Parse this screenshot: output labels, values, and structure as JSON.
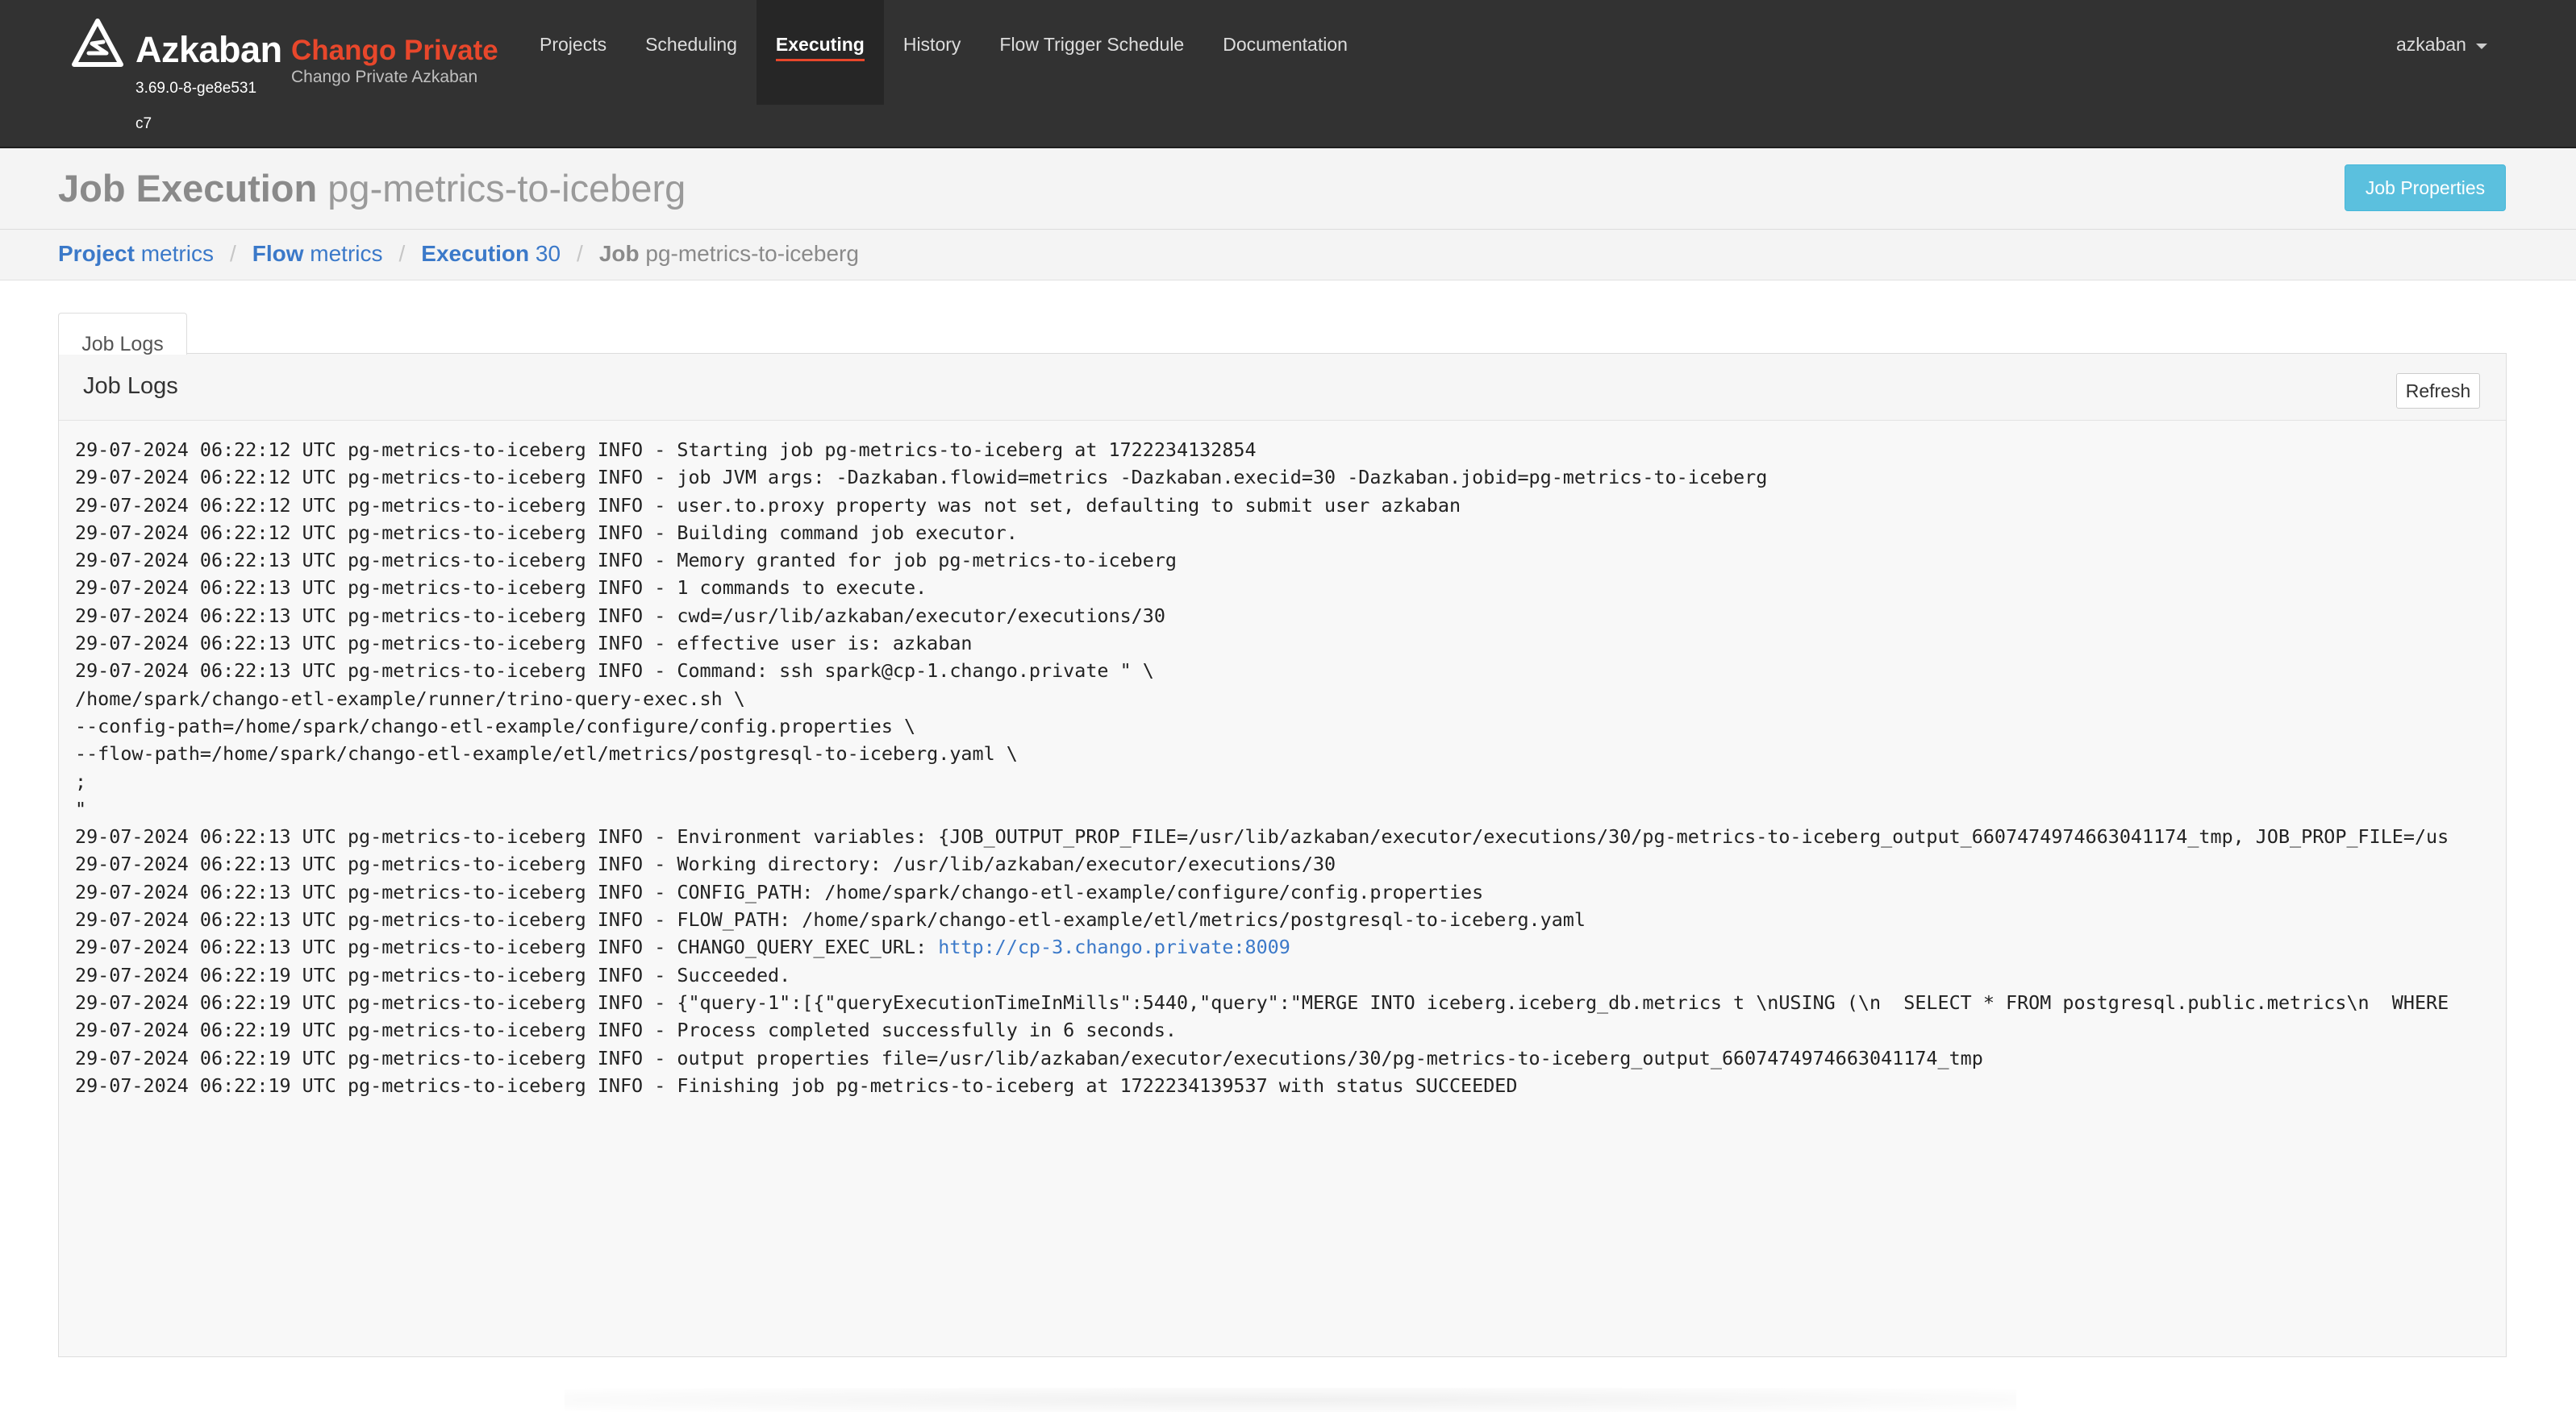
{
  "navbar": {
    "brand": "Azkaban",
    "brand_sub": "Chango Private",
    "brand_sub2": "Chango Private Azkaban",
    "version": "3.69.0-8-ge8e531c7",
    "items": [
      "Projects",
      "Scheduling",
      "Executing",
      "History",
      "Flow Trigger Schedule",
      "Documentation"
    ],
    "active_index": 2,
    "user": "azkaban"
  },
  "header": {
    "title_label": "Job Execution",
    "title_value": "pg-metrics-to-iceberg",
    "job_properties_button": "Job Properties"
  },
  "breadcrumb": {
    "project_label": "Project",
    "project_value": "metrics",
    "flow_label": "Flow",
    "flow_value": "metrics",
    "execution_label": "Execution",
    "execution_value": "30",
    "job_label": "Job",
    "job_value": "pg-metrics-to-iceberg"
  },
  "tab": {
    "label": "Job Logs"
  },
  "panel": {
    "title": "Job Logs",
    "refresh_button": "Refresh",
    "log_lines": [
      "29-07-2024 06:22:12 UTC pg-metrics-to-iceberg INFO - Starting job pg-metrics-to-iceberg at 1722234132854",
      "29-07-2024 06:22:12 UTC pg-metrics-to-iceberg INFO - job JVM args: -Dazkaban.flowid=metrics -Dazkaban.execid=30 -Dazkaban.jobid=pg-metrics-to-iceberg",
      "29-07-2024 06:22:12 UTC pg-metrics-to-iceberg INFO - user.to.proxy property was not set, defaulting to submit user azkaban",
      "29-07-2024 06:22:12 UTC pg-metrics-to-iceberg INFO - Building command job executor.",
      "29-07-2024 06:22:13 UTC pg-metrics-to-iceberg INFO - Memory granted for job pg-metrics-to-iceberg",
      "29-07-2024 06:22:13 UTC pg-metrics-to-iceberg INFO - 1 commands to execute.",
      "29-07-2024 06:22:13 UTC pg-metrics-to-iceberg INFO - cwd=/usr/lib/azkaban/executor/executions/30",
      "29-07-2024 06:22:13 UTC pg-metrics-to-iceberg INFO - effective user is: azkaban",
      "29-07-2024 06:22:13 UTC pg-metrics-to-iceberg INFO - Command: ssh spark@cp-1.chango.private \" \\",
      "/home/spark/chango-etl-example/runner/trino-query-exec.sh \\",
      "--config-path=/home/spark/chango-etl-example/configure/config.properties \\",
      "--flow-path=/home/spark/chango-etl-example/etl/metrics/postgresql-to-iceberg.yaml \\",
      ";",
      "\"",
      "29-07-2024 06:22:13 UTC pg-metrics-to-iceberg INFO - Environment variables: {JOB_OUTPUT_PROP_FILE=/usr/lib/azkaban/executor/executions/30/pg-metrics-to-iceberg_output_6607474974663041174_tmp, JOB_PROP_FILE=/us",
      "29-07-2024 06:22:13 UTC pg-metrics-to-iceberg INFO - Working directory: /usr/lib/azkaban/executor/executions/30",
      "29-07-2024 06:22:13 UTC pg-metrics-to-iceberg INFO - CONFIG_PATH: /home/spark/chango-etl-example/configure/config.properties",
      "29-07-2024 06:22:13 UTC pg-metrics-to-iceberg INFO - FLOW_PATH: /home/spark/chango-etl-example/etl/metrics/postgresql-to-iceberg.yaml",
      "29-07-2024 06:22:13 UTC pg-metrics-to-iceberg INFO - CHANGO_QUERY_EXEC_URL: ",
      "29-07-2024 06:22:19 UTC pg-metrics-to-iceberg INFO - Succeeded.",
      "29-07-2024 06:22:19 UTC pg-metrics-to-iceberg INFO - {\"query-1\":[{\"queryExecutionTimeInMills\":5440,\"query\":\"MERGE INTO iceberg.iceberg_db.metrics t \\nUSING (\\n  SELECT * FROM postgresql.public.metrics\\n  WHERE",
      "29-07-2024 06:22:19 UTC pg-metrics-to-iceberg INFO - Process completed successfully in 6 seconds.",
      "29-07-2024 06:22:19 UTC pg-metrics-to-iceberg INFO - output properties file=/usr/lib/azkaban/executor/executions/30/pg-metrics-to-iceberg_output_6607474974663041174_tmp",
      "29-07-2024 06:22:19 UTC pg-metrics-to-iceberg INFO - Finishing job pg-metrics-to-iceberg at 1722234139537 with status SUCCEEDED"
    ],
    "query_exec_url": "http://cp-3.chango.private:8009"
  }
}
